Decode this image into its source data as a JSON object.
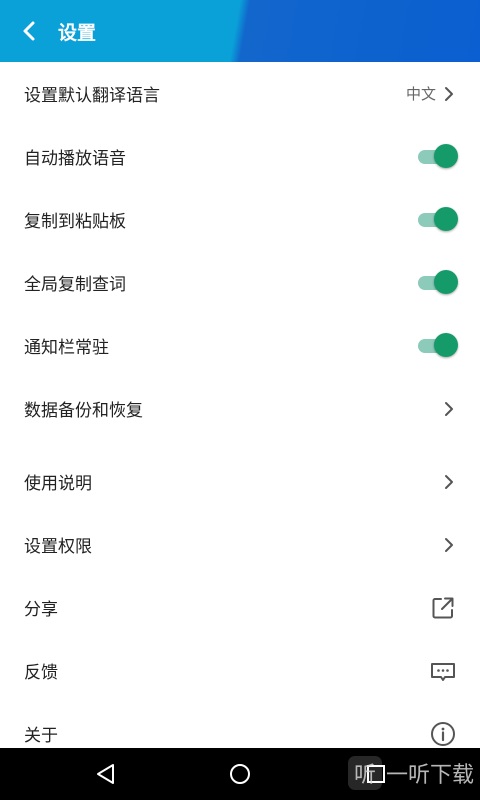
{
  "header": {
    "title": "设置"
  },
  "settings": {
    "translate_language": {
      "label": "设置默认翻译语言",
      "value": "中文"
    },
    "autoplay_voice": {
      "label": "自动播放语音",
      "enabled": true
    },
    "copy_to_clipboard": {
      "label": "复制到粘贴板",
      "enabled": true
    },
    "global_copy_lookup": {
      "label": "全局复制查词",
      "enabled": true
    },
    "notification_resident": {
      "label": "通知栏常驻",
      "enabled": true
    },
    "backup_restore": {
      "label": "数据备份和恢复"
    },
    "instructions": {
      "label": "使用说明"
    },
    "permissions": {
      "label": "设置权限"
    },
    "share": {
      "label": "分享",
      "icon": "share-external-icon"
    },
    "feedback": {
      "label": "反馈",
      "icon": "chat-bubble-icon"
    },
    "about": {
      "label": "关于",
      "icon": "info-icon"
    }
  },
  "navbar": {
    "buttons": [
      "back-triangle-icon",
      "home-circle-icon",
      "recents-square-icon"
    ]
  },
  "watermark": {
    "text": "一听下载",
    "logo_char": "听"
  },
  "colors": {
    "toggle_on": "#159b6a",
    "toggle_track": "#8ccaba",
    "header_left": "#0aa0d8",
    "header_right": "#0b5fd0"
  }
}
